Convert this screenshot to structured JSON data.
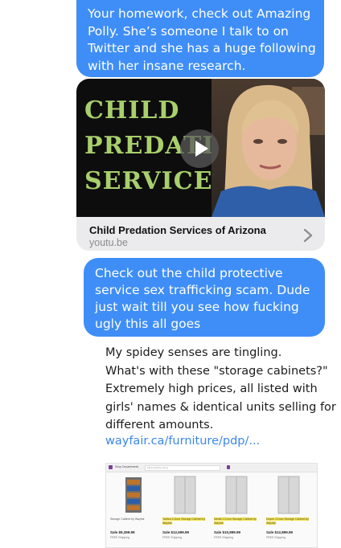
{
  "messages": {
    "sent_1": "Your homework, check out Amazing Polly. She’s someone I talk to on Twitter and she has a huge following with her insane research.",
    "link_preview": {
      "thumbnail_text": [
        "CHILD",
        "PREDATION",
        "SERVICES"
      ],
      "title": "Child Predation Services of Arizona",
      "domain": "youtu.be"
    },
    "sent_2": "Check out the child protective service sex trafficking scam. Dude just wait till you see how fucking ugly this all goes"
  },
  "tweet": {
    "lines": [
      "My spidey senses are tingling.",
      "What's with these \"storage cabinets?\"",
      "Extremely high prices, all listed with",
      "girls' names & identical units selling for",
      "different amounts."
    ],
    "link": "wayfair.ca/furniture/pdp/..."
  },
  "embed": {
    "header": "Shop Departments",
    "search_placeholder": "Find anything home",
    "products": [
      {
        "title": "Storage Cabinet by Wayfair",
        "price": "Sale $9,399.99",
        "ship": "FREE Shipping"
      },
      {
        "title": "Yaritza 2-Door Storage Cabinet by Wayfair",
        "price": "Sale $12,699.99",
        "ship": "FREE Shipping"
      },
      {
        "title": "Neriah 2-Door Storage Cabinet by Wayfair",
        "price": "Sale $10,899.99",
        "ship": "FREE Shipping"
      },
      {
        "title": "Duyen 2-Door Storage Cabinet by Wayfair",
        "price": "Sale $12,899.99",
        "ship": "FREE Shipping"
      }
    ]
  },
  "colors": {
    "sent_bubble": "#3f8ef7",
    "link_text": "#3b87e6",
    "thumbnail_text": "#a9cf6c"
  }
}
